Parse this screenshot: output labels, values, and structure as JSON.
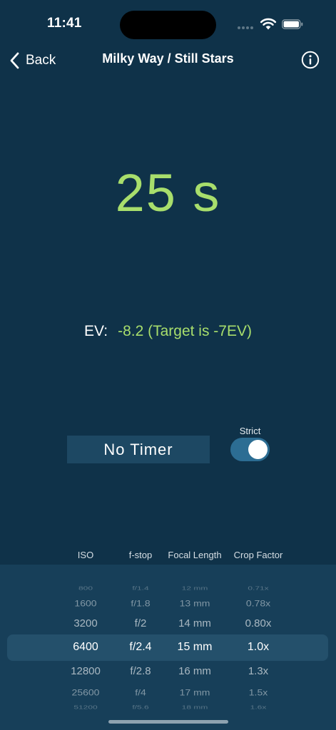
{
  "status_bar": {
    "time": "11:41"
  },
  "nav": {
    "back_label": "Back",
    "title": "Milky Way / Still Stars"
  },
  "exposure": {
    "value": "25 s"
  },
  "ev": {
    "label": "EV:",
    "value": "-8.2 (Target is -7EV)"
  },
  "timer": {
    "label": "No Timer"
  },
  "strict": {
    "label": "Strict",
    "on": true
  },
  "picker": {
    "headers": [
      "ISO",
      "f-stop",
      "Focal Length",
      "Crop Factor"
    ],
    "rows": [
      [
        "800",
        "f/1.4",
        "12 mm",
        "0.71x"
      ],
      [
        "1600",
        "f/1.8",
        "13 mm",
        "0.78x"
      ],
      [
        "3200",
        "f/2",
        "14 mm",
        "0.80x"
      ],
      [
        "6400",
        "f/2.4",
        "15 mm",
        "1.0x"
      ],
      [
        "12800",
        "f/2.8",
        "16 mm",
        "1.3x"
      ],
      [
        "25600",
        "f/4",
        "17 mm",
        "1.5x"
      ],
      [
        "51200",
        "f/5.6",
        "18 mm",
        "1.6x"
      ]
    ],
    "selected_index": 3
  },
  "colors": {
    "background": "#0f3249",
    "accent_green": "#a8de6c",
    "toggle_on": "#2c6d93"
  }
}
